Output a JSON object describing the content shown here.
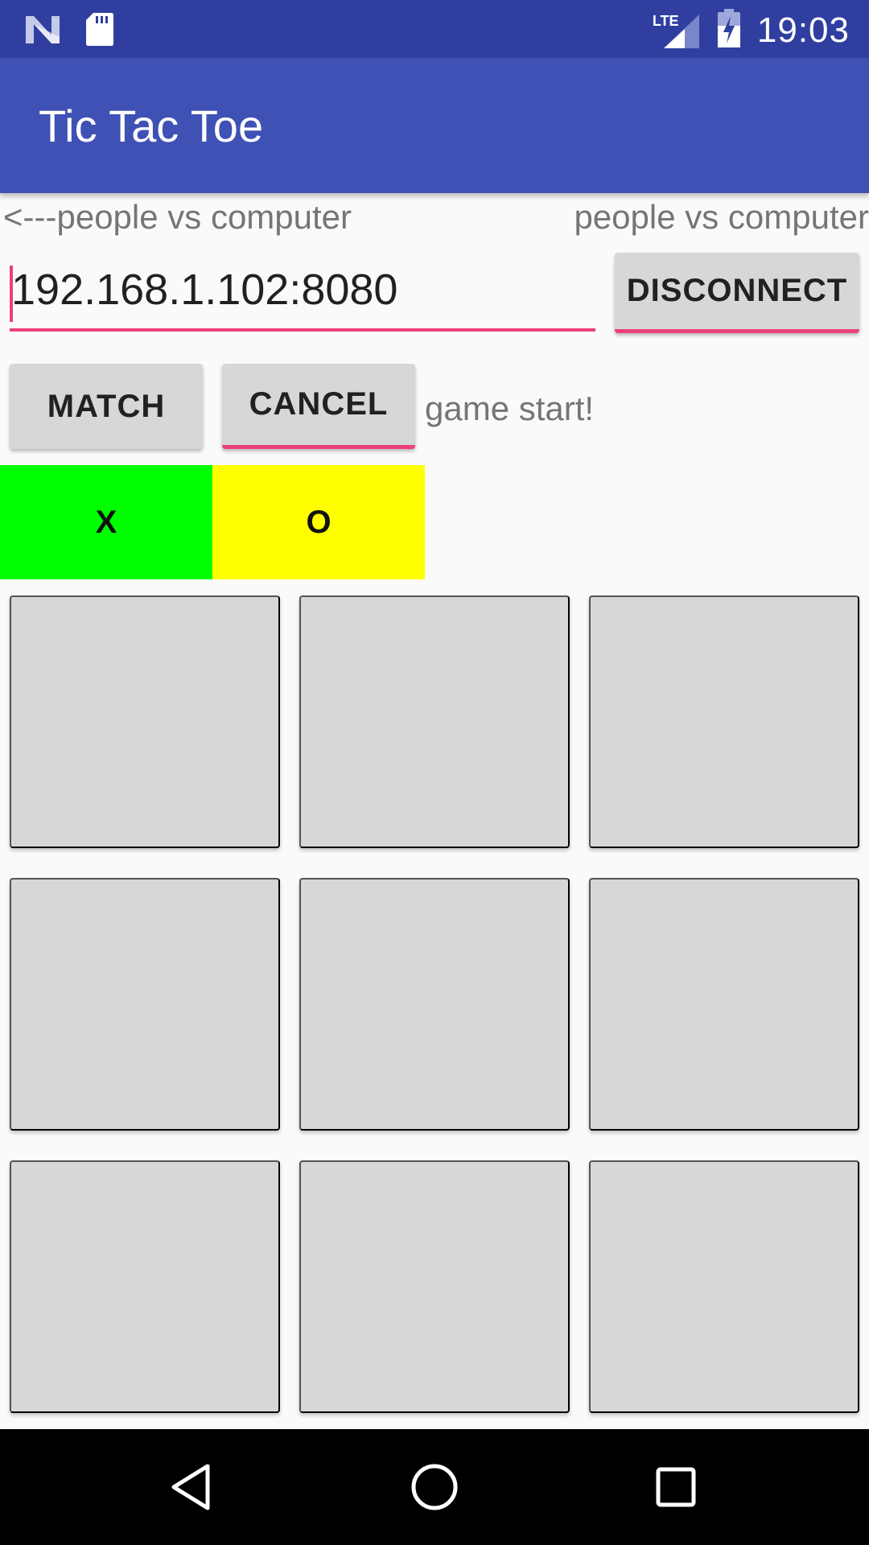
{
  "status_bar": {
    "time": "19:03",
    "network_label": "LTE",
    "icons": [
      "notification-n-icon",
      "sd-card-icon",
      "lte-signal-icon",
      "battery-charging-icon"
    ]
  },
  "app_bar": {
    "title": "Tic Tac Toe"
  },
  "mode": {
    "left_label": "<---people vs computer",
    "right_label": "people vs computer"
  },
  "connection": {
    "address_value": "192.168.1.102:8080",
    "disconnect_label": "DISCONNECT"
  },
  "controls": {
    "match_label": "MATCH",
    "cancel_label": "CANCEL",
    "status_text": "game start!"
  },
  "players": {
    "x_label": "X",
    "o_label": "O",
    "x_color": "#00ff00",
    "o_color": "#ffff00"
  },
  "board": {
    "cells": [
      "",
      "",
      "",
      "",
      "",
      "",
      "",
      "",
      ""
    ]
  },
  "colors": {
    "status_bar": "#303f9f",
    "app_bar": "#3f51b5",
    "accent": "#ec407a",
    "button": "#d6d7d7"
  },
  "nav_bar": {
    "icons": [
      "back-icon",
      "home-icon",
      "recent-apps-icon"
    ]
  }
}
